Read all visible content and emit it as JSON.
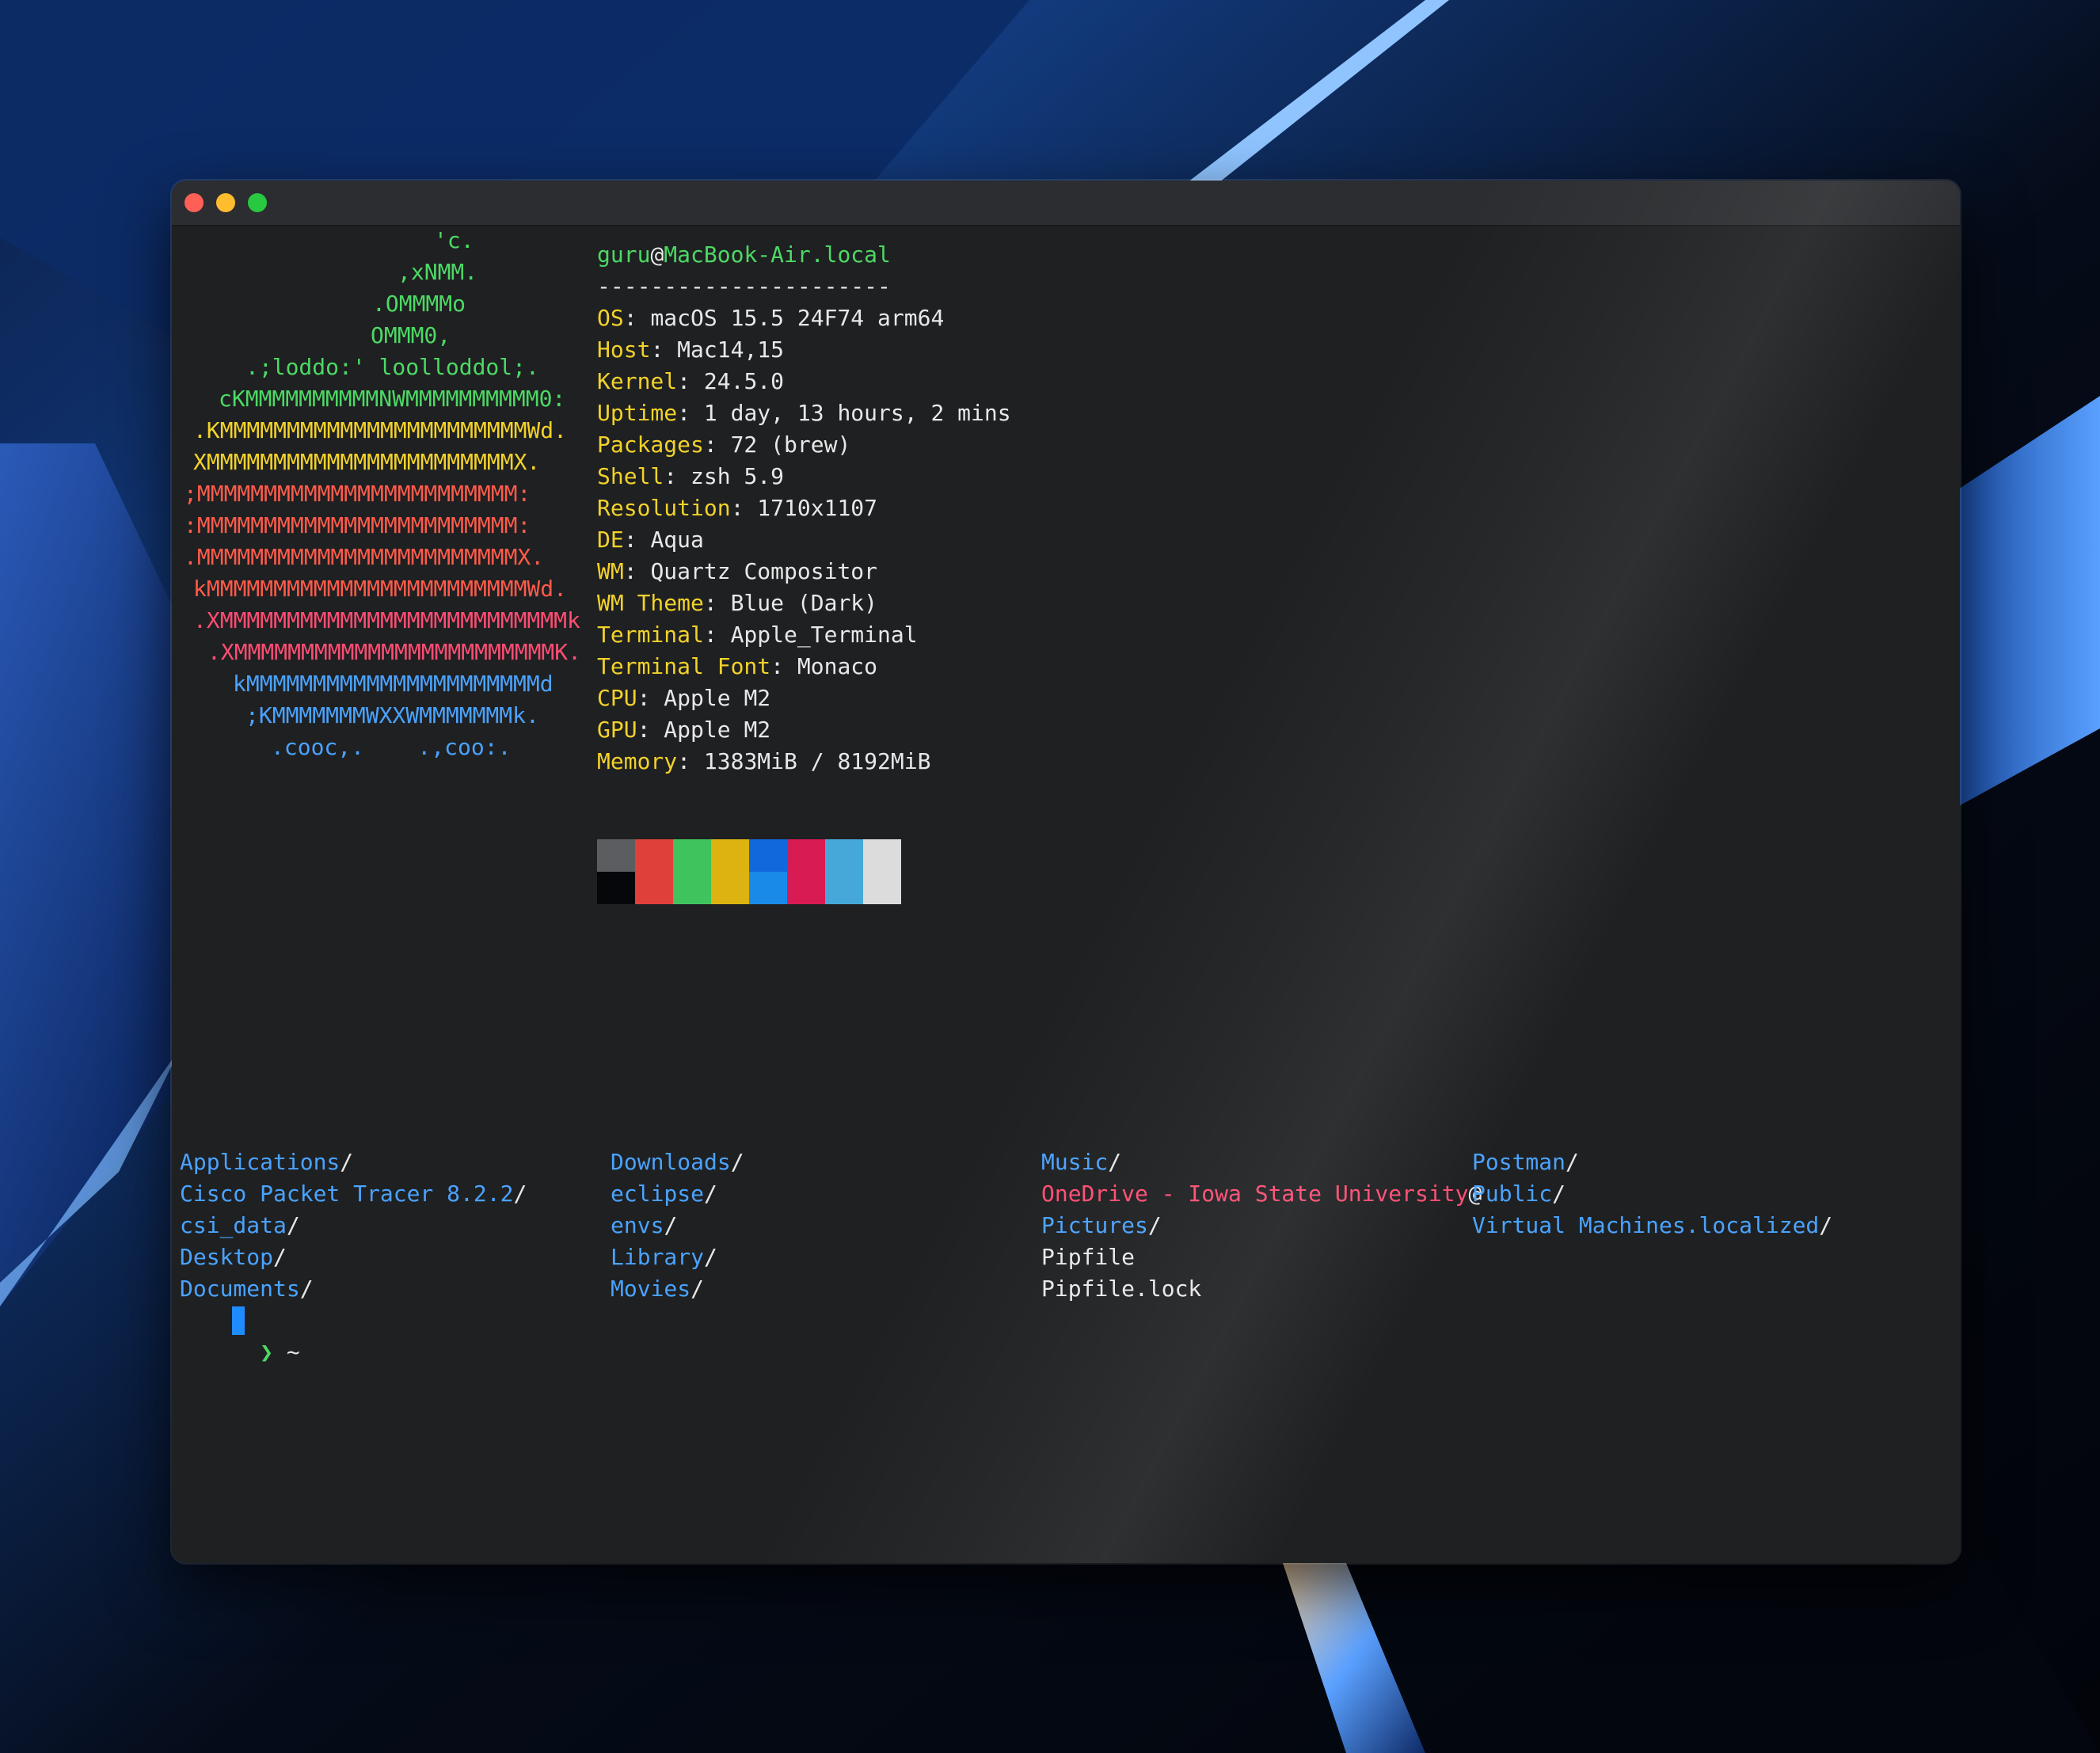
{
  "window": {
    "title": ""
  },
  "logo_lines": [
    {
      "text": "'c.",
      "color": "#4cd964"
    },
    {
      "text": ",xNMM.",
      "color": "#4cd964"
    },
    {
      "text": ".OMMMMo",
      "color": "#4cd964"
    },
    {
      "text": "OMMM0,",
      "color": "#4cd964"
    },
    {
      "text": ".;loddo:' loolloddol;.",
      "color": "#4cd964"
    },
    {
      "text": "cKMMMMMMMMMMNWMMMMMMMMMM0:",
      "color": "#4cd964"
    },
    {
      "text": ".KMMMMMMMMMMMMMMMMMMMMMMMWd.",
      "color": "#f2d22a"
    },
    {
      "text": "XMMMMMMMMMMMMMMMMMMMMMMMX.",
      "color": "#f2d22a"
    },
    {
      "text": ";MMMMMMMMMMMMMMMMMMMMMMMM:",
      "color": "#ff5b4a"
    },
    {
      "text": ":MMMMMMMMMMMMMMMMMMMMMMMM:",
      "color": "#ff5b4a"
    },
    {
      "text": ".MMMMMMMMMMMMMMMMMMMMMMMMX.",
      "color": "#ff5b4a"
    },
    {
      "text": "kMMMMMMMMMMMMMMMMMMMMMMMMWd.",
      "color": "#ff5b4a"
    },
    {
      "text": ".XMMMMMMMMMMMMMMMMMMMMMMMMMMk",
      "color": "#ff4d73"
    },
    {
      "text": ".XMMMMMMMMMMMMMMMMMMMMMMMMK.",
      "color": "#ff4d73"
    },
    {
      "text": "kMMMMMMMMMMMMMMMMMMMMMMd",
      "color": "#4aa3ff"
    },
    {
      "text": ";KMMMMMMMWXXWMMMMMMMk.",
      "color": "#4aa3ff"
    },
    {
      "text": ".cooc,.    .,coo:.",
      "color": "#4aa3ff"
    }
  ],
  "info": {
    "user": "guru",
    "at": "@",
    "host": "MacBook-Air.local",
    "separator": "----------------------",
    "rows": [
      {
        "key": "OS",
        "value": "macOS 15.5 24F74 arm64"
      },
      {
        "key": "Host",
        "value": "Mac14,15"
      },
      {
        "key": "Kernel",
        "value": "24.5.0"
      },
      {
        "key": "Uptime",
        "value": "1 day, 13 hours, 2 mins"
      },
      {
        "key": "Packages",
        "value": "72 (brew)"
      },
      {
        "key": "Shell",
        "value": "zsh 5.9"
      },
      {
        "key": "Resolution",
        "value": "1710x1107"
      },
      {
        "key": "DE",
        "value": "Aqua"
      },
      {
        "key": "WM",
        "value": "Quartz Compositor"
      },
      {
        "key": "WM Theme",
        "value": "Blue (Dark)"
      },
      {
        "key": "Terminal",
        "value": "Apple_Terminal"
      },
      {
        "key": "Terminal Font",
        "value": "Monaco"
      },
      {
        "key": "CPU",
        "value": "Apple M2"
      },
      {
        "key": "GPU",
        "value": "Apple M2"
      },
      {
        "key": "Memory",
        "value": "1383MiB / 8192MiB"
      }
    ]
  },
  "palette": {
    "top": [
      "#5b5d61",
      "#e0403a",
      "#3fc45d",
      "#dcb310",
      "#1068dc",
      "#d81b52",
      "#46a8d8",
      "#dcdcdc"
    ],
    "bottom": [
      "#06070a",
      "#e0403a",
      "#3fc45d",
      "#dcb310",
      "#1a8ae8",
      "#d81b52",
      "#46a8d8",
      "#dcdcdc"
    ]
  },
  "ls_columns": [
    [
      {
        "name": "Applications",
        "suffix": "/",
        "kind": "dir"
      },
      {
        "name": "Cisco Packet Tracer 8.2.2",
        "suffix": "/",
        "kind": "dir"
      },
      {
        "name": "csi_data",
        "suffix": "/",
        "kind": "dir"
      },
      {
        "name": "Desktop",
        "suffix": "/",
        "kind": "dir"
      },
      {
        "name": "Documents",
        "suffix": "/",
        "kind": "dir"
      }
    ],
    [
      {
        "name": "Downloads",
        "suffix": "/",
        "kind": "dir"
      },
      {
        "name": "eclipse",
        "suffix": "/",
        "kind": "dir"
      },
      {
        "name": "envs",
        "suffix": "/",
        "kind": "dir"
      },
      {
        "name": "Library",
        "suffix": "/",
        "kind": "dir"
      },
      {
        "name": "Movies",
        "suffix": "/",
        "kind": "dir"
      }
    ],
    [
      {
        "name": "Music",
        "suffix": "/",
        "kind": "dir"
      },
      {
        "name": "OneDrive - Iowa State University",
        "suffix": "@",
        "kind": "onedrive"
      },
      {
        "name": "Pictures",
        "suffix": "/",
        "kind": "dir"
      },
      {
        "name": "Pipfile",
        "suffix": "",
        "kind": "plain"
      },
      {
        "name": "Pipfile.lock",
        "suffix": "",
        "kind": "plain"
      }
    ],
    [
      {
        "name": "Postman",
        "suffix": "/",
        "kind": "dir"
      },
      {
        "name": "Public",
        "suffix": "/",
        "kind": "dir"
      },
      {
        "name": "Virtual Machines.localized",
        "suffix": "/",
        "kind": "dir"
      }
    ]
  ],
  "prompt": {
    "arrow": "❯",
    "path": "~"
  },
  "colors": {
    "accent_green": "#4cd964",
    "accent_yellow": "#f2d22a",
    "dir_blue": "#4aa3ff",
    "link_pink": "#ff4d73",
    "cursor_blue": "#1e8cff",
    "window_bg": "#1f2022"
  }
}
